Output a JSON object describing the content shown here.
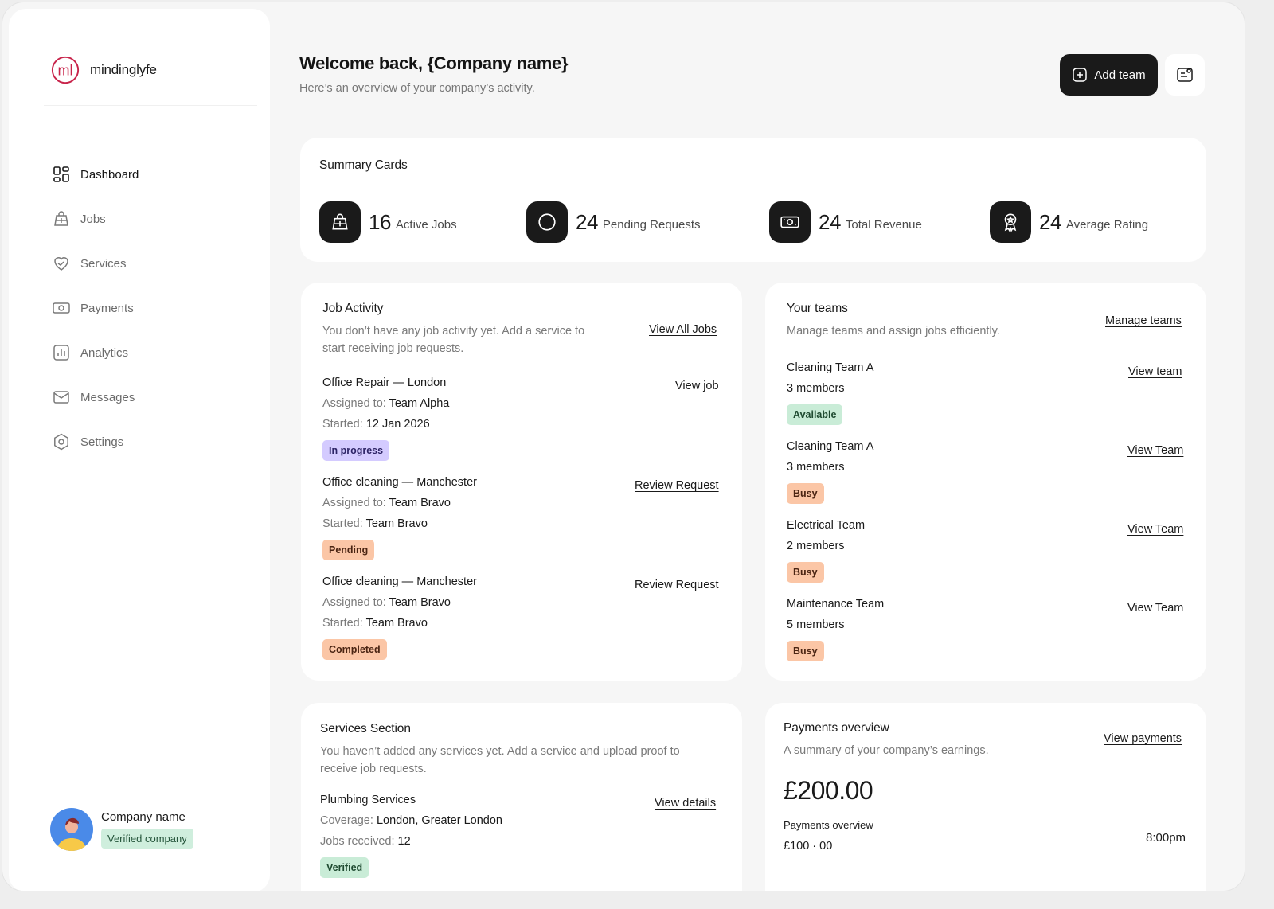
{
  "brand": {
    "name": "mindinglyfe",
    "accent": "#c8234a"
  },
  "nav": {
    "items": [
      {
        "label": "Dashboard",
        "icon": "dashboard-grid-icon",
        "active": true
      },
      {
        "label": "Jobs",
        "icon": "jobs-bag-icon"
      },
      {
        "label": "Services",
        "icon": "services-heart-icon"
      },
      {
        "label": "Payments",
        "icon": "payments-cash-icon"
      },
      {
        "label": "Analytics",
        "icon": "analytics-chart-icon"
      },
      {
        "label": "Messages",
        "icon": "messages-envelope-icon"
      },
      {
        "label": "Settings",
        "icon": "settings-hex-icon"
      }
    ]
  },
  "profile": {
    "name": "Company name",
    "badge": "Verified company"
  },
  "header": {
    "title": "Welcome back, {Company name}",
    "subtitle": "Here’s an overview of your company’s activity.",
    "add_team_label": "Add team"
  },
  "summary": {
    "title": "Summary Cards",
    "stats": [
      {
        "value": "16",
        "label": "Active Jobs",
        "icon": "jobs-bag-icon"
      },
      {
        "value": "24",
        "label": "Pending Requests",
        "icon": "circle-icon"
      },
      {
        "value": "24",
        "label": "Total Revenue",
        "icon": "cash-icon"
      },
      {
        "value": "24",
        "label": "Average Rating",
        "icon": "award-ribbon-icon"
      }
    ]
  },
  "jobs": {
    "title": "Job Activity",
    "description": "You don’t have any job activity yet. Add a service to start receiving job requests.",
    "view_all": "View All Jobs",
    "assigned_prefix": "Assigned to:",
    "started_prefix": "Started:",
    "items": [
      {
        "title": "Office Repair — London",
        "assigned": "Team Alpha",
        "started": "12 Jan 2026",
        "status": "In progress",
        "action": "View job"
      },
      {
        "title": "Office cleaning — Manchester",
        "assigned": "Team Bravo",
        "started": "Team Bravo",
        "status": "Pending",
        "action": "Review Request"
      },
      {
        "title": "Office cleaning — Manchester",
        "assigned": "Team Bravo",
        "started": "Team Bravo",
        "status": "Completed",
        "action": "Review Request"
      }
    ]
  },
  "teams": {
    "title": "Your teams",
    "description": "Manage teams and assign jobs efficiently.",
    "manage": "Manage teams",
    "items": [
      {
        "name": "Cleaning Team A",
        "members": "3 members",
        "status": "Available",
        "action": "View team"
      },
      {
        "name": "Cleaning Team A",
        "members": "3 members",
        "status": "Busy",
        "action": "View Team"
      },
      {
        "name": "Electrical Team",
        "members": "2 members",
        "status": "Busy",
        "action": "View Team"
      },
      {
        "name": "Maintenance Team",
        "members": "5 members",
        "status": "Busy",
        "action": "View Team"
      }
    ]
  },
  "services": {
    "title": "Services Section",
    "description": "You haven’t added any services yet. Add a service and upload proof to receive job requests.",
    "item": {
      "title": "Plumbing Services",
      "coverage_prefix": "Coverage:",
      "coverage": "London, Greater London",
      "jobs_prefix": "Jobs received:",
      "jobs": "12",
      "status": "Verified",
      "action": "View details"
    }
  },
  "payments": {
    "title": "Payments overview",
    "description": "A summary of your company’s earnings.",
    "action": "View payments",
    "total": "£200.00",
    "sub_label": "Payments overview",
    "sub_amount": "£100 · 00",
    "time": "8:00pm"
  }
}
